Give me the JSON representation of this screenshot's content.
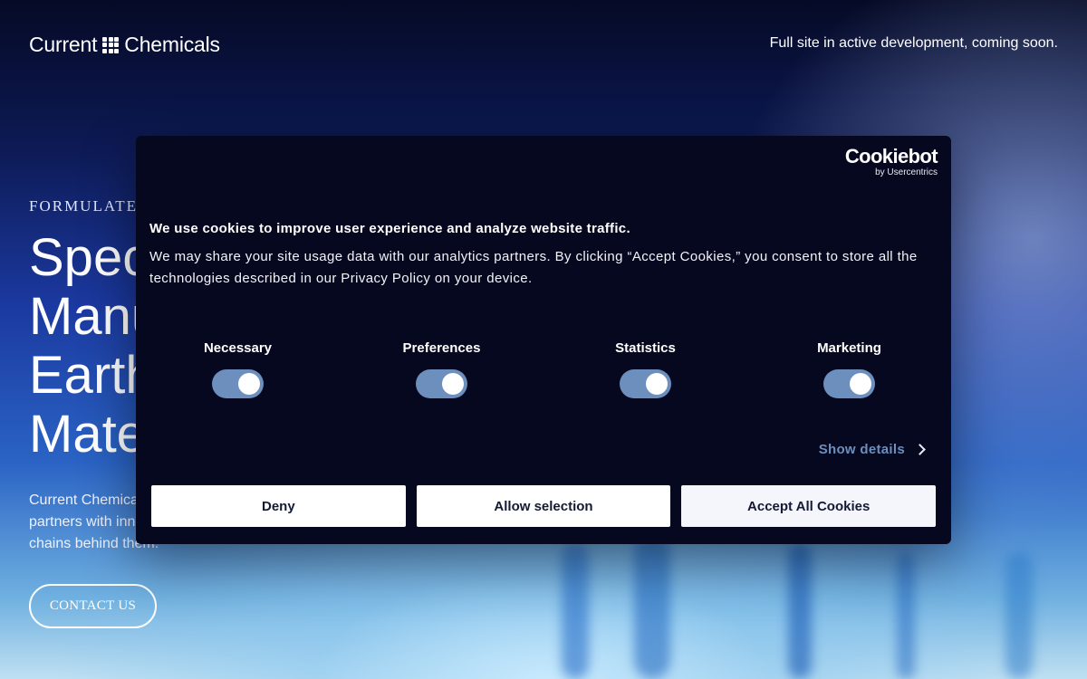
{
  "header": {
    "logo_left": "Current",
    "logo_right": "Chemicals",
    "notice": "Full site in active development, coming soon."
  },
  "hero": {
    "eyebrow": "FORMULATE W",
    "title_lines": [
      "Spec",
      "Manu",
      "Earth",
      "Mate"
    ],
    "text_lines": [
      "Current Chemica",
      "partners with inn",
      "chains behind them."
    ],
    "cta": "CONTACT US"
  },
  "cookie_banner": {
    "brand": "Cookiebot",
    "brand_sub": "by Usercentrics",
    "heading": "We use cookies to improve user experience and analyze website traffic.",
    "body": "We may share your site usage data with our analytics partners. By clicking “Accept Cookies,” you consent to store all the technologies described in our Privacy Policy on your device.",
    "categories": [
      {
        "label": "Necessary",
        "enabled": true
      },
      {
        "label": "Preferences",
        "enabled": true
      },
      {
        "label": "Statistics",
        "enabled": true
      },
      {
        "label": "Marketing",
        "enabled": true
      }
    ],
    "show_details": "Show details",
    "buttons": {
      "deny": "Deny",
      "allow_selection": "Allow selection",
      "accept_all": "Accept All Cookies"
    }
  },
  "colors": {
    "dialog_bg": "#06081f",
    "toggle_on": "#6c8fbd",
    "link": "#6c8fbd"
  }
}
